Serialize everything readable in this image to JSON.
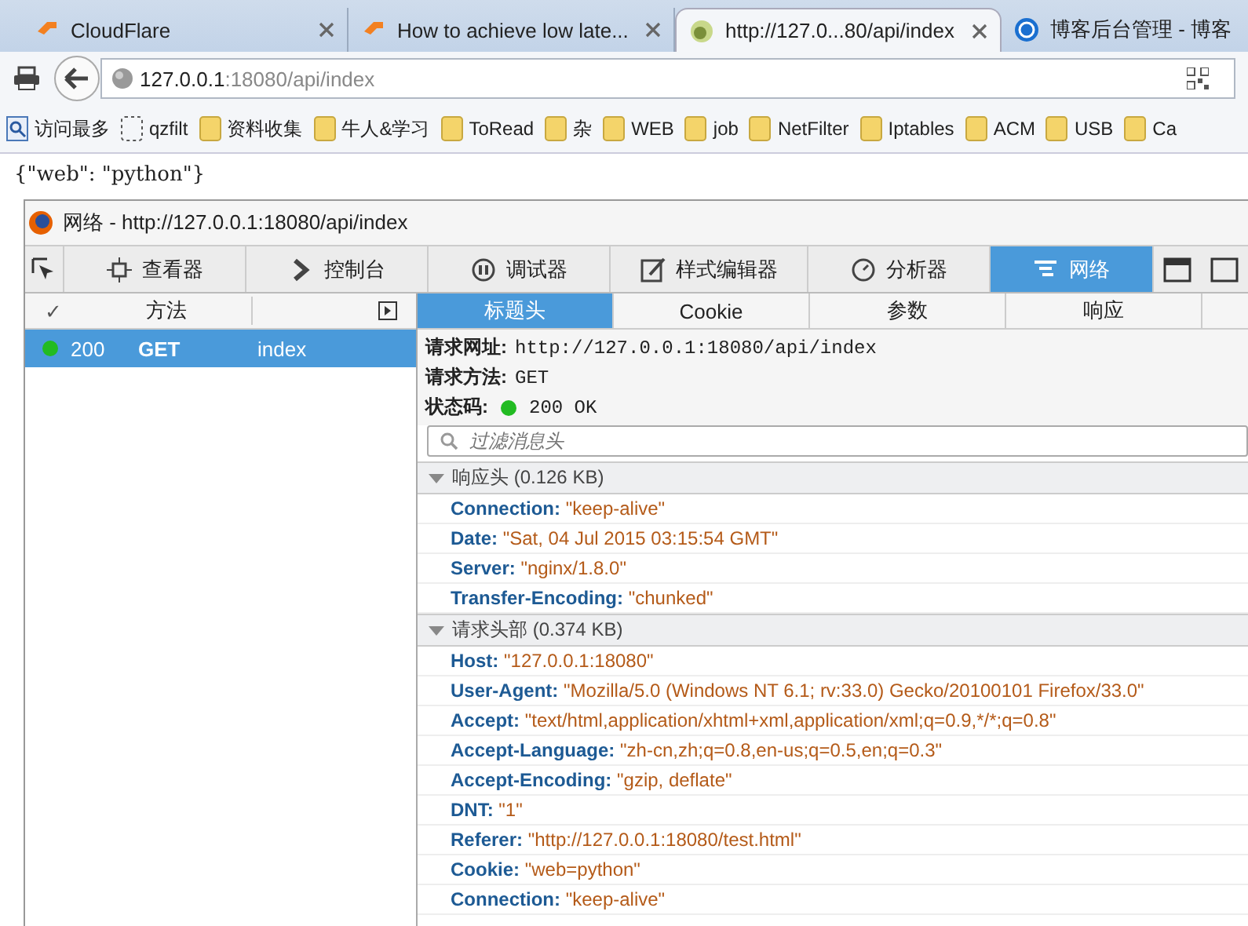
{
  "browser_tabs": [
    {
      "title": "CloudFlare",
      "kind": "cf",
      "selected": false
    },
    {
      "title": "How to achieve low late...",
      "kind": "cf",
      "selected": false
    },
    {
      "title": "http://127.0...80/api/index",
      "kind": "page",
      "selected": true
    },
    {
      "title": "博客后台管理 - 博客",
      "kind": "site",
      "selected": false
    }
  ],
  "address_bar": {
    "host": "127.0.0.1",
    "path": ":18080/api/index"
  },
  "bookmarks": [
    {
      "label": "访问最多",
      "kind": "smart"
    },
    {
      "label": "qzfilt",
      "kind": "dashed"
    },
    {
      "label": "资料收集",
      "kind": "folder"
    },
    {
      "label": "牛人&学习",
      "kind": "folder"
    },
    {
      "label": "ToRead",
      "kind": "folder"
    },
    {
      "label": "杂",
      "kind": "folder"
    },
    {
      "label": "WEB",
      "kind": "folder"
    },
    {
      "label": "job",
      "kind": "folder"
    },
    {
      "label": "NetFilter",
      "kind": "folder"
    },
    {
      "label": "Iptables",
      "kind": "folder"
    },
    {
      "label": "ACM",
      "kind": "folder"
    },
    {
      "label": "USB",
      "kind": "folder"
    },
    {
      "label": "Ca",
      "kind": "folder"
    }
  ],
  "page_text": "{\"web\": \"python\"}",
  "devtools": {
    "title": "网络 - http://127.0.0.1:18080/api/index",
    "tools": [
      {
        "label": "查看器",
        "kind": "inspector",
        "selected": false
      },
      {
        "label": "控制台",
        "kind": "console",
        "selected": false
      },
      {
        "label": "调试器",
        "kind": "debugger",
        "selected": false
      },
      {
        "label": "样式编辑器",
        "kind": "style",
        "selected": false
      },
      {
        "label": "分析器",
        "kind": "profiler",
        "selected": false
      },
      {
        "label": "网络",
        "kind": "network",
        "selected": true
      }
    ],
    "request_columns": {
      "column_1": "✓",
      "method": "方法"
    },
    "requests": [
      {
        "status": "200",
        "method": "GET",
        "file": "index",
        "color": "#22bb22",
        "selected": true
      }
    ],
    "detail_tabs": [
      {
        "label": "标题头",
        "selected": true
      },
      {
        "label": "Cookie",
        "selected": false
      },
      {
        "label": "参数",
        "selected": false
      },
      {
        "label": "响应",
        "selected": false
      }
    ],
    "summary": [
      {
        "label": "请求网址:",
        "value": "http://127.0.0.1:18080/api/index"
      },
      {
        "label": "请求方法:",
        "value": "GET"
      },
      {
        "label": "状态码:",
        "value": "200 OK",
        "color": "#22bb22"
      }
    ],
    "filter": {
      "placeholder": "过滤消息头"
    },
    "sections": [
      {
        "title": "响应头 (0.126 KB)",
        "expanded": true,
        "headers": [
          {
            "name": "Connection:",
            "value": "\"keep-alive\""
          },
          {
            "name": "Date:",
            "value": "\"Sat, 04 Jul 2015 03:15:54 GMT\""
          },
          {
            "name": "Server:",
            "value": "\"nginx/1.8.0\""
          },
          {
            "name": "Transfer-Encoding:",
            "value": "\"chunked\""
          }
        ]
      },
      {
        "title": "请求头部 (0.374 KB)",
        "expanded": true,
        "headers": [
          {
            "name": "Host:",
            "value": "\"127.0.0.1:18080\""
          },
          {
            "name": "User-Agent:",
            "value": "\"Mozilla/5.0 (Windows NT 6.1; rv:33.0) Gecko/20100101 Firefox/33.0\""
          },
          {
            "name": "Accept:",
            "value": "\"text/html,application/xhtml+xml,application/xml;q=0.9,*/*;q=0.8\""
          },
          {
            "name": "Accept-Language:",
            "value": "\"zh-cn,zh;q=0.8,en-us;q=0.5,en;q=0.3\""
          },
          {
            "name": "Accept-Encoding:",
            "value": "\"gzip, deflate\""
          },
          {
            "name": "DNT:",
            "value": "\"1\""
          },
          {
            "name": "Referer:",
            "value": "\"http://127.0.0.1:18080/test.html\""
          },
          {
            "name": "Cookie:",
            "value": "\"web=python\""
          },
          {
            "name": "Connection:",
            "value": "\"keep-alive\""
          }
        ]
      }
    ]
  }
}
